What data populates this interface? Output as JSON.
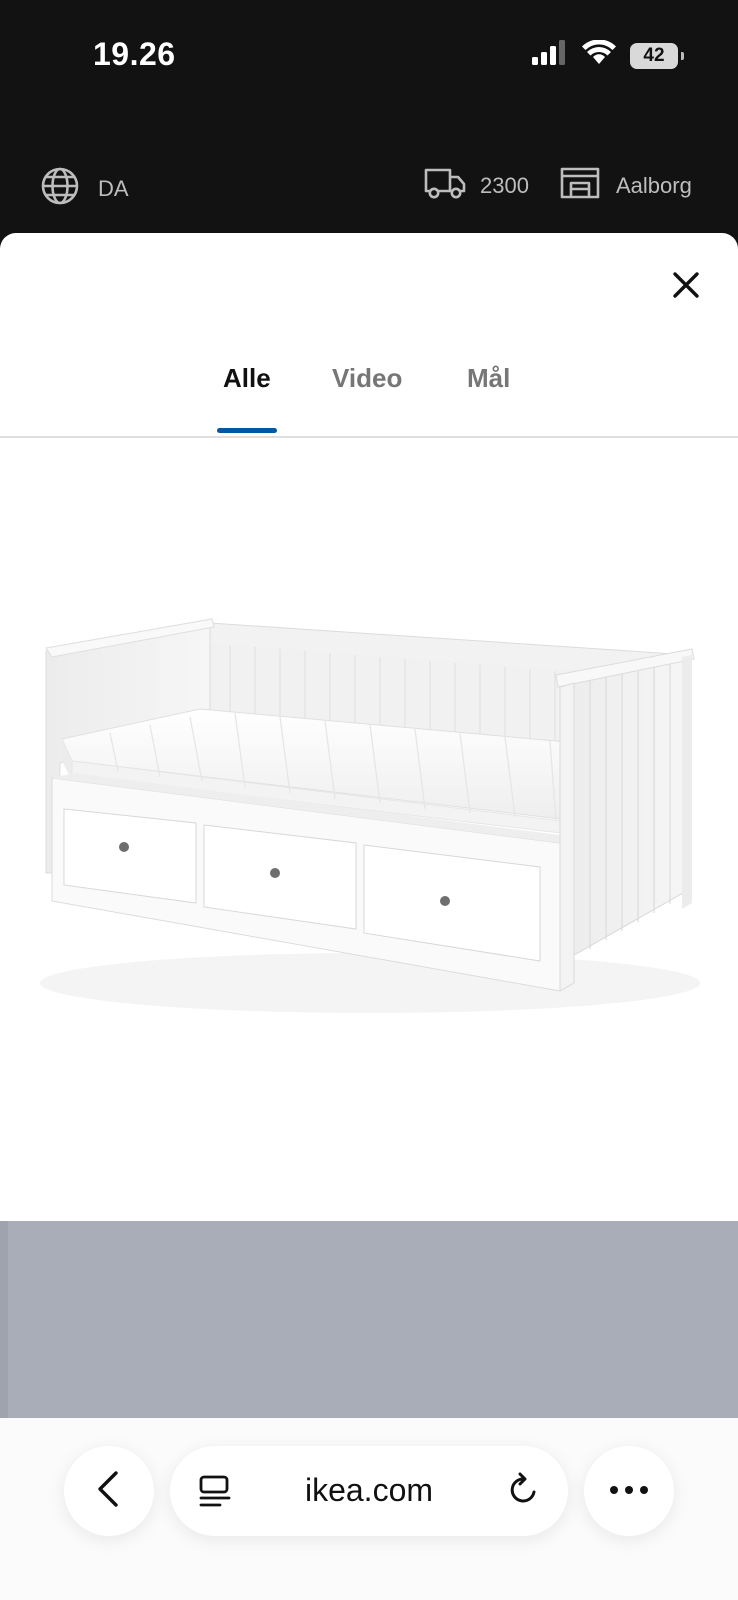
{
  "status_bar": {
    "time": "19.26",
    "battery": "42"
  },
  "site_header": {
    "language": "DA",
    "postcode": "2300",
    "store": "Aalborg"
  },
  "tabs": [
    {
      "label": "Alle",
      "active": true
    },
    {
      "label": "Video",
      "active": false
    },
    {
      "label": "Mål",
      "active": false
    }
  ],
  "browser": {
    "url": "ikea.com"
  },
  "colors": {
    "accent": "#0058a3",
    "background": "#121212",
    "band": "#a8adb8"
  },
  "icons": [
    "signal-icon",
    "wifi-icon",
    "globe-icon",
    "truck-icon",
    "store-icon",
    "close-icon",
    "back-icon",
    "reader-icon",
    "reload-icon",
    "more-icon"
  ]
}
